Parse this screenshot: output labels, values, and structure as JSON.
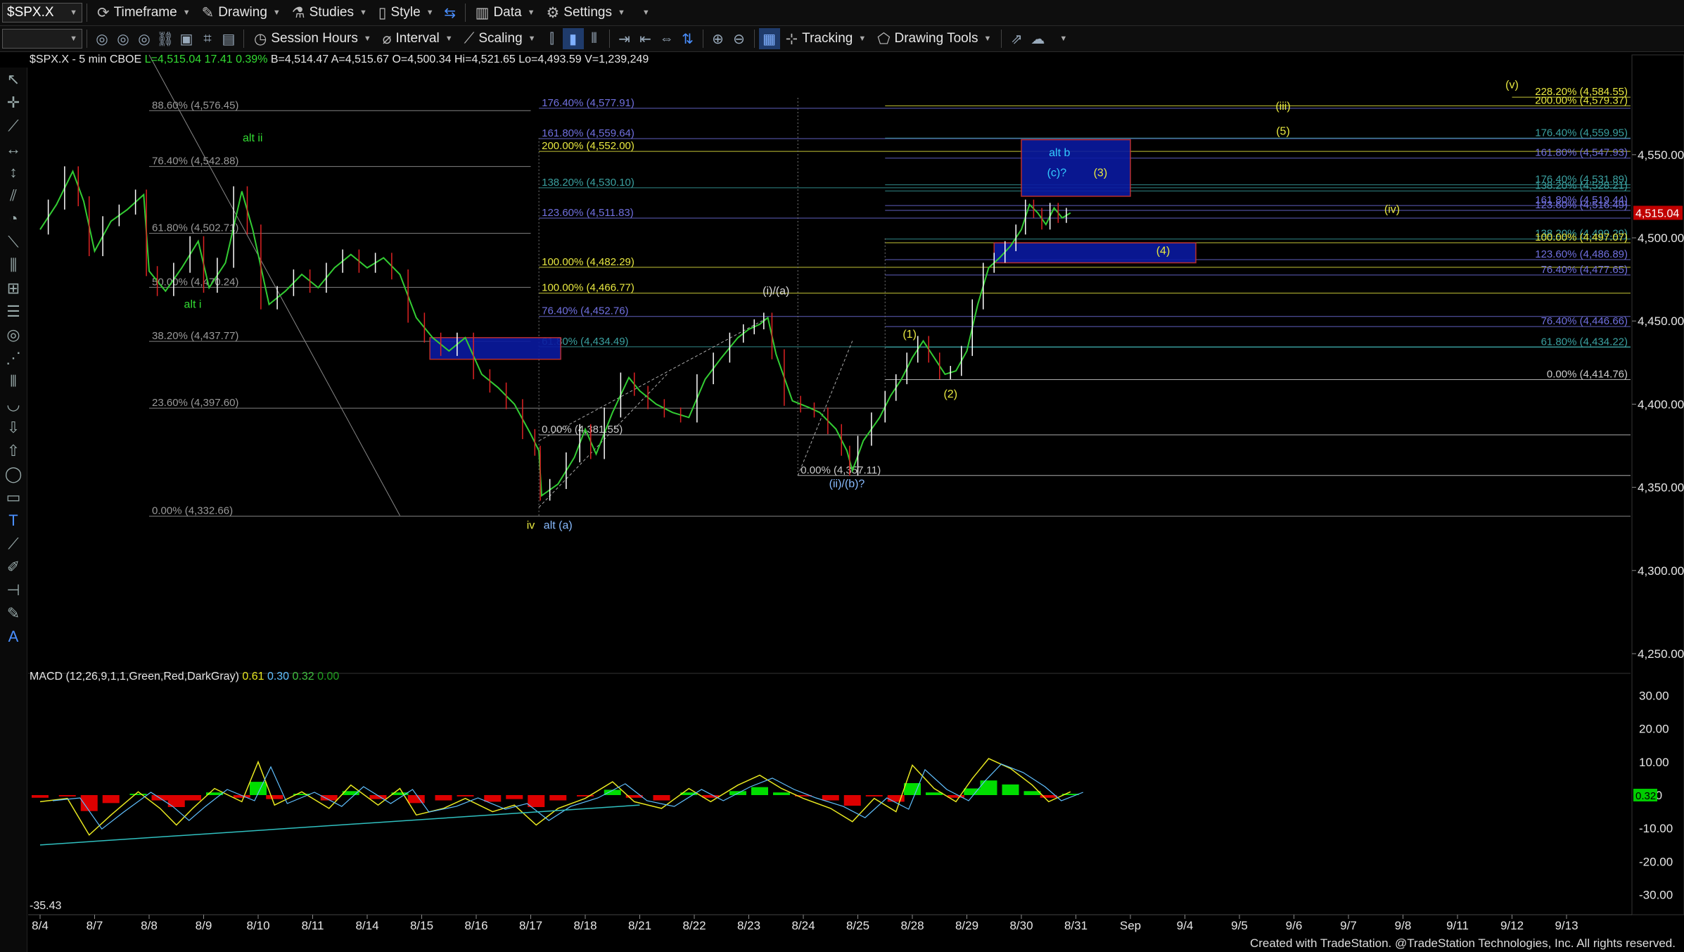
{
  "toolbar1": {
    "symbol": "$SPX.X",
    "items": [
      {
        "label": "Timeframe",
        "icon": "timeframe-icon"
      },
      {
        "label": "Drawing",
        "icon": "pencil-icon"
      },
      {
        "label": "Studies",
        "icon": "flask-icon"
      },
      {
        "label": "Style",
        "icon": "style-icon"
      },
      {
        "label": "Data",
        "icon": "data-icon"
      },
      {
        "label": "Settings",
        "icon": "gear-icon"
      }
    ]
  },
  "toolbar2": {
    "session_label": "Session Hours",
    "interval_label": "Interval",
    "scaling_label": "Scaling",
    "tracking_label": "Tracking",
    "drawing_tools_label": "Drawing Tools"
  },
  "header": {
    "prefix": "$SPX.X - 5 min  CBOE",
    "fields": [
      {
        "text": "L=4,515.04",
        "color": "#33dd33"
      },
      {
        "text": "17.41",
        "color": "#33dd33"
      },
      {
        "text": "0.39%",
        "color": "#33dd33"
      },
      {
        "text": "B=4,514.47",
        "color": "#e6e6e6"
      },
      {
        "text": "A=4,515.67",
        "color": "#e6e6e6"
      },
      {
        "text": "O=4,500.34",
        "color": "#e6e6e6"
      },
      {
        "text": "Hi=4,521.65",
        "color": "#e6e6e6"
      },
      {
        "text": "Lo=4,493.59",
        "color": "#e6e6e6"
      },
      {
        "text": "V=1,239,249",
        "color": "#e6e6e6"
      }
    ]
  },
  "macd": {
    "label": "MACD (12,26,9,1,1,Green,Red,DarkGray)",
    "values": [
      {
        "text": "0.61",
        "color": "#e8e820"
      },
      {
        "text": "0.30",
        "color": "#60c0ff"
      },
      {
        "text": "0.32",
        "color": "#40c040"
      },
      {
        "text": "0.00",
        "color": "#20a020"
      }
    ],
    "last": "0.32",
    "low_label": "-35.43"
  },
  "credit": "Created with TradeStation. @TradeStation Technologies, Inc. All rights reserved.",
  "chart_data": {
    "type": "candlestick",
    "title": "$SPX.X - 5 min",
    "y_ticks": [
      "4,550.00",
      "4,500.00",
      "4,450.00",
      "4,400.00",
      "4,350.00",
      "4,300.00",
      "4,250.00"
    ],
    "ylim": [
      4239,
      4610
    ],
    "last_price": "4,515.04",
    "x_ticks": [
      "8/4",
      "8/7",
      "8/8",
      "8/9",
      "8/10",
      "8/11",
      "8/14",
      "8/15",
      "8/16",
      "8/17",
      "8/18",
      "8/21",
      "8/22",
      "8/23",
      "8/24",
      "8/25",
      "8/28",
      "8/29",
      "8/30",
      "8/31",
      "Sep",
      "9/4",
      "9/5",
      "9/6",
      "9/7",
      "9/8",
      "9/11",
      "9/12",
      "9/13"
    ],
    "price_path": [
      [
        0,
        4505
      ],
      [
        0.3,
        4520
      ],
      [
        0.6,
        4540
      ],
      [
        0.8,
        4522
      ],
      [
        1.0,
        4492
      ],
      [
        1.3,
        4510
      ],
      [
        1.6,
        4517
      ],
      [
        1.9,
        4526
      ],
      [
        2.0,
        4480
      ],
      [
        2.3,
        4468
      ],
      [
        2.6,
        4482
      ],
      [
        2.9,
        4498
      ],
      [
        3.1,
        4470
      ],
      [
        3.4,
        4485
      ],
      [
        3.7,
        4528
      ],
      [
        3.9,
        4505
      ],
      [
        4.2,
        4460
      ],
      [
        4.5,
        4468
      ],
      [
        4.8,
        4478
      ],
      [
        5.1,
        4470
      ],
      [
        5.4,
        4482
      ],
      [
        5.7,
        4490
      ],
      [
        6.0,
        4482
      ],
      [
        6.3,
        4488
      ],
      [
        6.6,
        4478
      ],
      [
        6.9,
        4452
      ],
      [
        7.2,
        4440
      ],
      [
        7.5,
        4432
      ],
      [
        7.8,
        4440
      ],
      [
        8.1,
        4418
      ],
      [
        8.4,
        4410
      ],
      [
        8.7,
        4400
      ],
      [
        9.0,
        4382
      ],
      [
        9.15,
        4372
      ],
      [
        9.2,
        4345
      ],
      [
        9.5,
        4352
      ],
      [
        9.8,
        4368
      ],
      [
        10.0,
        4385
      ],
      [
        10.2,
        4370
      ],
      [
        10.5,
        4395
      ],
      [
        10.8,
        4416
      ],
      [
        11.0,
        4408
      ],
      [
        11.3,
        4400
      ],
      [
        11.6,
        4395
      ],
      [
        11.9,
        4392
      ],
      [
        12.2,
        4415
      ],
      [
        12.5,
        4428
      ],
      [
        12.8,
        4440
      ],
      [
        13.0,
        4445
      ],
      [
        13.2,
        4448
      ],
      [
        13.35,
        4452
      ],
      [
        13.5,
        4430
      ],
      [
        13.8,
        4402
      ],
      [
        14.1,
        4398
      ],
      [
        14.3,
        4395
      ],
      [
        14.6,
        4385
      ],
      [
        14.8,
        4372
      ],
      [
        14.9,
        4360
      ],
      [
        15.1,
        4378
      ],
      [
        15.4,
        4392
      ],
      [
        15.6,
        4405
      ],
      [
        15.8,
        4415
      ],
      [
        16.0,
        4428
      ],
      [
        16.2,
        4438
      ],
      [
        16.4,
        4428
      ],
      [
        16.6,
        4418
      ],
      [
        16.8,
        4420
      ],
      [
        17.0,
        4432
      ],
      [
        17.2,
        4460
      ],
      [
        17.4,
        4482
      ],
      [
        17.6,
        4488
      ],
      [
        17.8,
        4495
      ],
      [
        18.0,
        4505
      ],
      [
        18.15,
        4520
      ],
      [
        18.3,
        4515
      ],
      [
        18.45,
        4508
      ],
      [
        18.6,
        4518
      ],
      [
        18.75,
        4512
      ],
      [
        18.9,
        4515
      ]
    ],
    "fib_levels": [
      {
        "label": "88.60% (4,576.45)",
        "price": 4576.45,
        "x0": 2,
        "x1": 9,
        "color": "#999999"
      },
      {
        "label": "76.40% (4,542.88)",
        "price": 4542.88,
        "x0": 2,
        "x1": 9,
        "color": "#999999"
      },
      {
        "label": "61.80% (4,502.71)",
        "price": 4502.71,
        "x0": 2,
        "x1": 9,
        "color": "#999999"
      },
      {
        "label": "50.00% (4,470.24)",
        "price": 4470.24,
        "x0": 2,
        "x1": 9,
        "color": "#999999"
      },
      {
        "label": "38.20% (4,437.77)",
        "price": 4437.77,
        "x0": 2,
        "x1": 9,
        "color": "#999999"
      },
      {
        "label": "23.60% (4,397.60)",
        "price": 4397.6,
        "x0": 2,
        "x1": 15.5,
        "color": "#999999"
      },
      {
        "label": "0.00% (4,332.66)",
        "price": 4332.66,
        "x0": 2,
        "x1": 29.5,
        "color": "#999999"
      },
      {
        "label": "176.40% (4,577.91)",
        "price": 4577.91,
        "x0": 9.15,
        "x1": 29.5,
        "color": "#7070e0"
      },
      {
        "label": "161.80% (4,559.64)",
        "price": 4559.64,
        "x0": 9.15,
        "x1": 29.5,
        "color": "#7070e0"
      },
      {
        "label": "138.20% (4,530.10)",
        "price": 4530.1,
        "x0": 9.15,
        "x1": 29.5,
        "color": "#3aa0a0"
      },
      {
        "label": "123.60% (4,511.83)",
        "price": 4511.83,
        "x0": 9.15,
        "x1": 29.5,
        "color": "#7070e0"
      },
      {
        "label": "100.00% (4,482.29)",
        "price": 4482.29,
        "x0": 9.15,
        "x1": 29.5,
        "color": "#e8e840"
      },
      {
        "label": "76.40% (4,452.76)",
        "price": 4452.76,
        "x0": 9.15,
        "x1": 29.5,
        "color": "#7070e0"
      },
      {
        "label": "61.80% (4,434.49)",
        "price": 4434.49,
        "x0": 9.15,
        "x1": 29.5,
        "color": "#3aa0a0"
      },
      {
        "label": "0.00% (4,357.11)",
        "price": 4357.11,
        "x0": 13.9,
        "x1": 29.5,
        "color": "#cccccc"
      },
      {
        "label": "228.20% (4,584.55)",
        "price": 4584.55,
        "x0": 27,
        "x1": 29.5,
        "color": "#e8e840"
      },
      {
        "label": "200.00% (4,579.37)",
        "price": 4579.37,
        "x0": 15.5,
        "x1": 29.5,
        "color": "#e8e840"
      },
      {
        "label": "176.40% (4,559.95)",
        "price": 4559.95,
        "x0": 15.5,
        "x1": 29.5,
        "color": "#3aa0a0"
      },
      {
        "label": "200.00% (4,552.00)",
        "price": 4552.0,
        "x0": 9.15,
        "x1": 29.5,
        "color": "#e8e840"
      },
      {
        "label": "161.80% (4,547.93)",
        "price": 4547.93,
        "x0": 15.5,
        "x1": 29.5,
        "color": "#7070e0"
      },
      {
        "label": "176.40% (4,531.89)",
        "price": 4531.89,
        "x0": 15.5,
        "x1": 29.5,
        "color": "#3aa0a0"
      },
      {
        "label": "138.20% (4,528.21)",
        "price": 4528.21,
        "x0": 15.5,
        "x1": 29.5,
        "color": "#3aa0a0"
      },
      {
        "label": "161.80% (4,519.44)",
        "price": 4519.44,
        "x0": 15.5,
        "x1": 29.5,
        "color": "#7070e0"
      },
      {
        "label": "123.60% (4,516.49)",
        "price": 4516.49,
        "x0": 15.5,
        "x1": 29.5,
        "color": "#7070e0"
      },
      {
        "label": "138.20% (4,499.29)",
        "price": 4499.29,
        "x0": 15.5,
        "x1": 29.5,
        "color": "#3aa0a0"
      },
      {
        "label": "100.00% (4,497.07)",
        "price": 4497.07,
        "x0": 15.5,
        "x1": 29.5,
        "color": "#e8e840"
      },
      {
        "label": "123.60% (4,486.89)",
        "price": 4486.89,
        "x0": 15.5,
        "x1": 29.5,
        "color": "#7070e0"
      },
      {
        "label": "76.40% (4,477.65)",
        "price": 4477.65,
        "x0": 15.5,
        "x1": 29.5,
        "color": "#7070e0"
      },
      {
        "label": "100.00% (4,466.77)",
        "price": 4466.77,
        "x0": 9.15,
        "x1": 29.5,
        "color": "#e8e840"
      },
      {
        "label": "76.40% (4,446.66)",
        "price": 4446.66,
        "x0": 15.5,
        "x1": 29.5,
        "color": "#7070e0"
      },
      {
        "label": "61.80% (4,434.22)",
        "price": 4434.22,
        "x0": 15.5,
        "x1": 29.5,
        "color": "#3aa0a0"
      },
      {
        "label": "0.00% (4,414.76)",
        "price": 4414.76,
        "x0": 15.5,
        "x1": 29.5,
        "color": "#cccccc"
      },
      {
        "label": "0.00% (4,381.55)",
        "price": 4381.55,
        "x0": 9.15,
        "x1": 29.5,
        "color": "#cccccc"
      }
    ],
    "target_boxes": [
      {
        "x0": 7.15,
        "x1": 9.55,
        "p0": 4427,
        "p1": 4440
      },
      {
        "x0": 18.0,
        "x1": 20.0,
        "p0": 4525,
        "p1": 4559
      },
      {
        "x0": 17.5,
        "x1": 21.2,
        "p0": 4485,
        "p1": 4497
      }
    ],
    "wave_labels": [
      {
        "text": "alt ii",
        "x": 3.9,
        "p": 4558,
        "color": "#33dd33"
      },
      {
        "text": "alt i",
        "x": 2.8,
        "p": 4458,
        "color": "#33dd33"
      },
      {
        "text": "iv",
        "x": 9.0,
        "p": 4325,
        "color": "#e8e840"
      },
      {
        "text": "alt (a)",
        "x": 9.5,
        "p": 4325,
        "color": "#88bbff"
      },
      {
        "text": "(i)/(a)",
        "x": 13.5,
        "p": 4466,
        "color": "#dddddd"
      },
      {
        "text": "(ii)/(b)?",
        "x": 14.8,
        "p": 4350,
        "color": "#88bbff"
      },
      {
        "text": "(1)",
        "x": 15.95,
        "p": 4440,
        "color": "#e8e840"
      },
      {
        "text": "(2)",
        "x": 16.7,
        "p": 4404,
        "color": "#e8e840"
      },
      {
        "text": "alt b",
        "x": 18.7,
        "p": 4549,
        "color": "#33ccff"
      },
      {
        "text": "(c)?",
        "x": 18.65,
        "p": 4537,
        "color": "#33ccff"
      },
      {
        "text": "(3)",
        "x": 19.45,
        "p": 4537,
        "color": "#e8e840"
      },
      {
        "text": "(4)",
        "x": 20.6,
        "p": 4490,
        "color": "#e8e840"
      },
      {
        "text": "(5)",
        "x": 22.8,
        "p": 4562,
        "color": "#e8e840"
      },
      {
        "text": "(iii)",
        "x": 22.8,
        "p": 4577,
        "color": "#e8e840"
      },
      {
        "text": "(iv)",
        "x": 24.8,
        "p": 4515,
        "color": "#e8e840"
      },
      {
        "text": "(v)",
        "x": 27.0,
        "p": 4590,
        "color": "#e8e840"
      }
    ],
    "macd_ticks": [
      "30.00",
      "20.00",
      "10.00",
      "0.00",
      "-10.00",
      "-20.00",
      "-30.00"
    ],
    "macd_ylim": [
      -36,
      36
    ],
    "macd_line": [
      [
        0,
        -2
      ],
      [
        0.5,
        -1
      ],
      [
        0.9,
        -12
      ],
      [
        1.3,
        -6
      ],
      [
        1.8,
        1
      ],
      [
        2.2,
        -4
      ],
      [
        2.5,
        -9
      ],
      [
        2.8,
        -4
      ],
      [
        3.2,
        2
      ],
      [
        3.7,
        -2
      ],
      [
        4.0,
        10
      ],
      [
        4.3,
        -3
      ],
      [
        4.8,
        1
      ],
      [
        5.3,
        -4
      ],
      [
        5.7,
        3
      ],
      [
        6.2,
        -3
      ],
      [
        6.6,
        2
      ],
      [
        6.9,
        -6
      ],
      [
        7.4,
        -4
      ],
      [
        7.8,
        -1
      ],
      [
        8.3,
        -5
      ],
      [
        8.7,
        -3
      ],
      [
        9.1,
        -9
      ],
      [
        9.5,
        -4
      ],
      [
        10.0,
        -1
      ],
      [
        10.5,
        4
      ],
      [
        10.9,
        -2
      ],
      [
        11.4,
        -4
      ],
      [
        11.9,
        2
      ],
      [
        12.3,
        -2
      ],
      [
        12.8,
        3
      ],
      [
        13.2,
        6
      ],
      [
        13.6,
        2
      ],
      [
        14.0,
        -1
      ],
      [
        14.5,
        -4
      ],
      [
        14.9,
        -8
      ],
      [
        15.3,
        -1
      ],
      [
        15.7,
        -5
      ],
      [
        16.0,
        9
      ],
      [
        16.4,
        2
      ],
      [
        16.8,
        -2
      ],
      [
        17.1,
        5
      ],
      [
        17.4,
        11
      ],
      [
        17.8,
        8
      ],
      [
        18.2,
        3
      ],
      [
        18.5,
        -2
      ],
      [
        18.9,
        1
      ]
    ],
    "macd_trendline": [
      [
        0,
        -15
      ],
      [
        11,
        -3
      ]
    ]
  }
}
